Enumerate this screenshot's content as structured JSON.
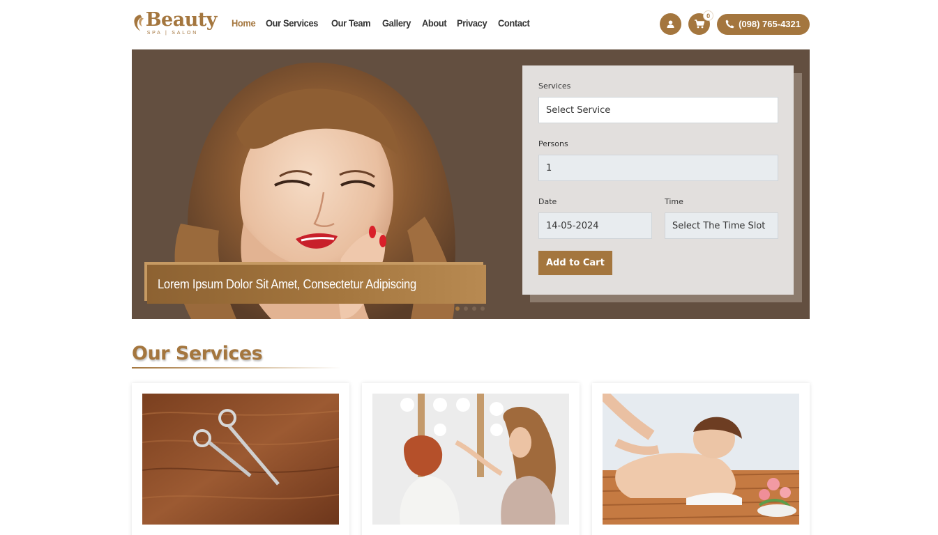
{
  "brand": {
    "name": "Beauty",
    "tagline": "SPA | SALON"
  },
  "nav": {
    "items": [
      {
        "label": "Home",
        "active": true
      },
      {
        "label": "Our Services",
        "active": false
      },
      {
        "label": "Our Team",
        "active": false
      },
      {
        "label": "Gallery",
        "active": false
      },
      {
        "label": "About",
        "active": false
      },
      {
        "label": "Privacy",
        "active": false
      },
      {
        "label": "Contact",
        "active": false
      }
    ]
  },
  "header": {
    "cart_count": "0",
    "phone": "(098) 765-4321",
    "icons": [
      "user-icon",
      "cart-icon",
      "phone-icon"
    ]
  },
  "hero": {
    "caption": "Lorem Ipsum Dolor Sit Amet, Consectetur Adipiscing",
    "slides": 4,
    "active_slide": 1
  },
  "booking": {
    "services_label": "Services",
    "services_value": "Select Service",
    "persons_label": "Persons",
    "persons_value": "1",
    "date_label": "Date",
    "date_value": "14-05-2024",
    "time_label": "Time",
    "time_value": "Select The Time Slot",
    "submit_label": "Add to Cart"
  },
  "services_section": {
    "title_light": "Our",
    "title_bold": "Services"
  },
  "colors": {
    "accent": "#a4763e",
    "hero_bg": "#634f40",
    "form_bg": "#e2dfdd"
  }
}
